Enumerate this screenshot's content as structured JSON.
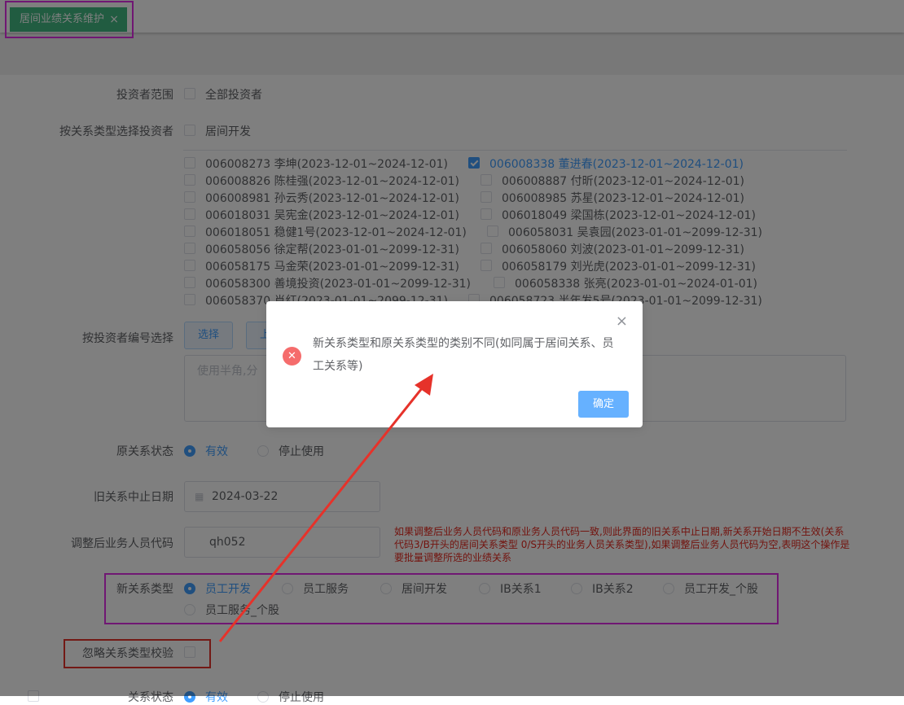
{
  "tab": {
    "label": "居间业绩关系维护",
    "close": "×"
  },
  "labels": {
    "investor_scope": "投资者范围",
    "by_relation_type": "按关系类型选择投资者",
    "by_investor_id": "按投资者编号选择",
    "orig_status": "原关系状态",
    "old_end_date": "旧关系中止日期",
    "adjusted_code": "调整后业务人员代码",
    "new_type": "新关系类型",
    "ignore_check": "忽略关系类型校验",
    "relation_status": "关系状态"
  },
  "scope": {
    "all_investors": "全部投资者"
  },
  "relation_type": {
    "option": "居间开发"
  },
  "investors": [
    {
      "text": "006008273 李坤(2023-12-01~2024-12-01)",
      "checked": false
    },
    {
      "text": "006008338 董进春(2023-12-01~2024-12-01)",
      "checked": true
    },
    {
      "text": "006008826 陈桂强(2023-12-01~2024-12-01)",
      "checked": false
    },
    {
      "text": "006008887 付昕(2023-12-01~2024-12-01)",
      "checked": false
    },
    {
      "text": "006008981 孙云秀(2023-12-01~2024-12-01)",
      "checked": false
    },
    {
      "text": "006008985 苏星(2023-12-01~2024-12-01)",
      "checked": false
    },
    {
      "text": "006018031 吴宪金(2023-12-01~2024-12-01)",
      "checked": false
    },
    {
      "text": "006018049 梁国栋(2023-12-01~2024-12-01)",
      "checked": false
    },
    {
      "text": "006018051 稳健1号(2023-12-01~2024-12-01)",
      "checked": false
    },
    {
      "text": "006058031 吴袁园(2023-01-01~2099-12-31)",
      "checked": false
    },
    {
      "text": "006058056 徐定帮(2023-01-01~2099-12-31)",
      "checked": false
    },
    {
      "text": "006058060 刘波(2023-01-01~2099-12-31)",
      "checked": false
    },
    {
      "text": "006058175 马金荣(2023-01-01~2099-12-31)",
      "checked": false
    },
    {
      "text": "006058179 刘光虎(2023-01-01~2099-12-31)",
      "checked": false
    },
    {
      "text": "006058300 善境投资(2023-01-01~2099-12-31)",
      "checked": false
    },
    {
      "text": "006058338 张亮(2023-01-01~2024-01-01)",
      "checked": false
    },
    {
      "text": "006058370 肖红(2023-01-01~2099-12-31)",
      "checked": false
    },
    {
      "text": "006058723 半年发5号(2023-01-01~2099-12-31)",
      "checked": false
    }
  ],
  "by_id": {
    "select_btn": "选择",
    "upload_btn": "上",
    "placeholder": "使用半角,分"
  },
  "orig_status": {
    "active": "有效",
    "stopped": "停止使用",
    "selected": "有效"
  },
  "old_end_date": {
    "value": "2024-03-22"
  },
  "adjusted_code": {
    "value": "qh052"
  },
  "hint": "如果调整后业务人员代码和原业务人员代码一致,则此界面的旧关系中止日期,新关系开始日期不生效(关系代码3/B开头的居间关系类型 0/S开头的业务人员关系类型),如果调整后业务人员代码为空,表明这个操作是要批量调整所选的业绩关系",
  "new_type": {
    "options": [
      "员工开发",
      "员工服务",
      "居间开发",
      "IB关系1",
      "IB关系2",
      "员工开发_个股",
      "员工服务_个股"
    ],
    "selected": "员工开发"
  },
  "relation_status": {
    "active": "有效",
    "stopped": "停止使用"
  },
  "dialog": {
    "message": "新关系类型和原关系类型的类别不同(如同属于居间关系、员工关系等)",
    "ok": "确定",
    "close": "×",
    "icon": "error-circle-icon"
  },
  "colors": {
    "accent": "#409eff",
    "tab_green": "#42b983",
    "error": "#f56c6c",
    "annotation_magenta": "#e12ee6",
    "annotation_red": "#e6322a"
  }
}
